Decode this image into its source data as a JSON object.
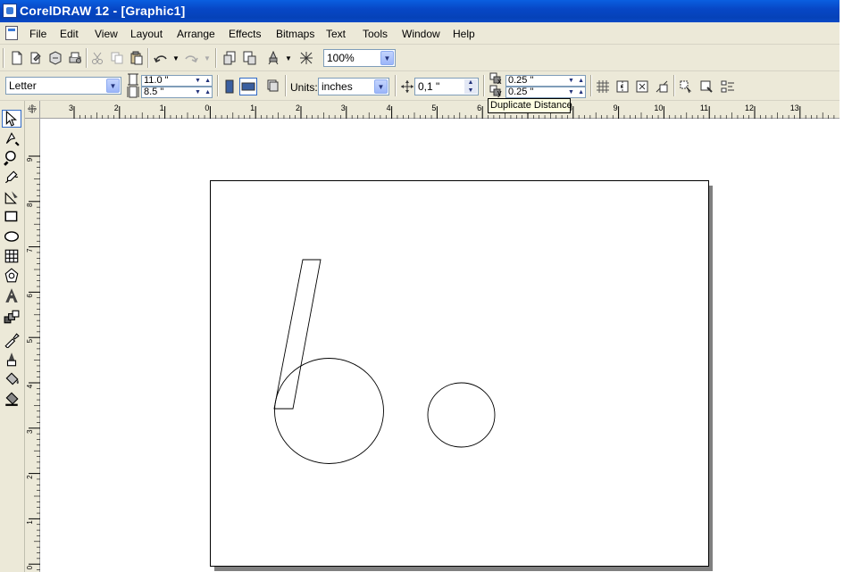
{
  "window": {
    "title": "CorelDRAW 12 - [Graphic1]"
  },
  "menubar": {
    "items": [
      "File",
      "Edit",
      "View",
      "Layout",
      "Arrange",
      "Effects",
      "Bitmaps",
      "Text",
      "Tools",
      "Window",
      "Help"
    ]
  },
  "standard_toolbar": {
    "icons": [
      "new-icon",
      "open-icon",
      "save-icon",
      "print-icon",
      "cut-icon",
      "copy-icon",
      "paste-icon",
      "undo-icon",
      "redo-icon",
      "import-icon",
      "export-icon",
      "application-launcher-icon",
      "welcome-screen-icon"
    ],
    "zoom_level": "100%"
  },
  "property_bar": {
    "paper_type": "Letter",
    "page_width": "11.0 \"",
    "page_height": "8.5 \"",
    "units_label": "Units:",
    "units_value": "inches",
    "nudge_distance": "0,1 \"",
    "duplicate_x": "0.25 \"",
    "duplicate_y": "0.25 \"",
    "x_subscript": "x",
    "y_subscript": "y"
  },
  "tooltip": {
    "text": "Duplicate Distance"
  },
  "horizontal_ruler": {
    "labels": [
      "3",
      "2",
      "1",
      "0",
      "1",
      "2",
      "3",
      "4",
      "5",
      "6",
      "7",
      "8",
      "9",
      "10",
      "11",
      "12",
      "13"
    ]
  },
  "vertical_ruler": {
    "labels": [
      "9",
      "8",
      "7",
      "6",
      "5",
      "4",
      "3",
      "2",
      "1",
      "0"
    ]
  },
  "toolbox": {
    "tools": [
      "pick-tool-icon",
      "shape-tool-icon",
      "zoom-tool-icon",
      "freehand-tool-icon",
      "smart-drawing-tool-icon",
      "rectangle-tool-icon",
      "ellipse-tool-icon",
      "graph-paper-tool-icon",
      "basic-shapes-tool-icon",
      "text-tool-icon",
      "interactive-blend-tool-icon",
      "eyedropper-tool-icon",
      "outline-tool-icon",
      "fill-tool-icon",
      "interactive-fill-tool-icon"
    ]
  },
  "colors": {
    "title_bar": "#0747c6",
    "chrome": "#ece9d8",
    "page_shadow": "#808080"
  }
}
